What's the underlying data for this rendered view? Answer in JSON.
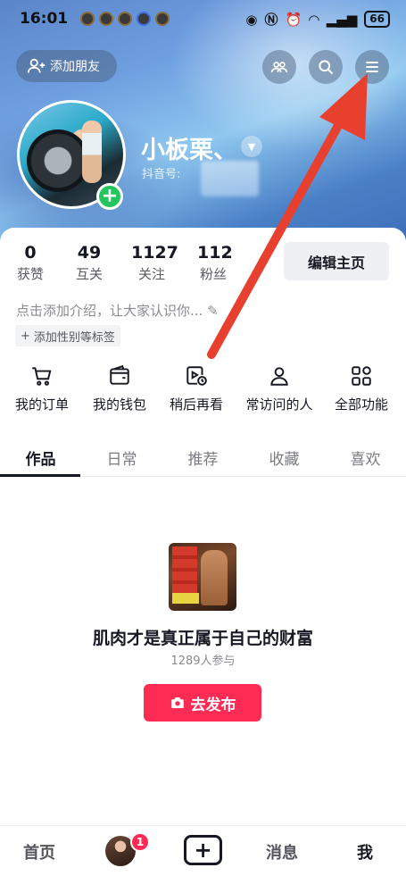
{
  "status_bar": {
    "time": "16:01",
    "battery": "66"
  },
  "header": {
    "add_friend_label": "添加朋友",
    "nickname": "小板栗、",
    "douyin_id_label": "抖音号: "
  },
  "stats": [
    {
      "value": "0",
      "label": "获赞"
    },
    {
      "value": "49",
      "label": "互关"
    },
    {
      "value": "1127",
      "label": "关注"
    },
    {
      "value": "112",
      "label": "粉丝"
    }
  ],
  "edit_profile_label": "编辑主页",
  "intro_placeholder": "点击添加介绍，让大家认识你...",
  "tag_chip_label": "添加性别等标签",
  "shortcuts": [
    {
      "label": "我的订单",
      "icon": "cart-icon"
    },
    {
      "label": "我的钱包",
      "icon": "wallet-icon"
    },
    {
      "label": "稍后再看",
      "icon": "watch-later-icon"
    },
    {
      "label": "常访问的人",
      "icon": "person-icon"
    },
    {
      "label": "全部功能",
      "icon": "grid-icon"
    }
  ],
  "tabs": [
    {
      "label": "作品",
      "active": true
    },
    {
      "label": "日常"
    },
    {
      "label": "推荐"
    },
    {
      "label": "收藏"
    },
    {
      "label": "喜欢"
    }
  ],
  "promo": {
    "title": "肌肉才是真正属于自己的财富",
    "participants": "1289人参与",
    "publish_label": "去发布"
  },
  "bottom_nav": {
    "home": "首页",
    "messages": "消息",
    "me": "我",
    "badge": "1"
  },
  "colors": {
    "accent": "#fe2c55",
    "annotation_arrow": "#e8402f",
    "online_dot": "#22c55e"
  }
}
